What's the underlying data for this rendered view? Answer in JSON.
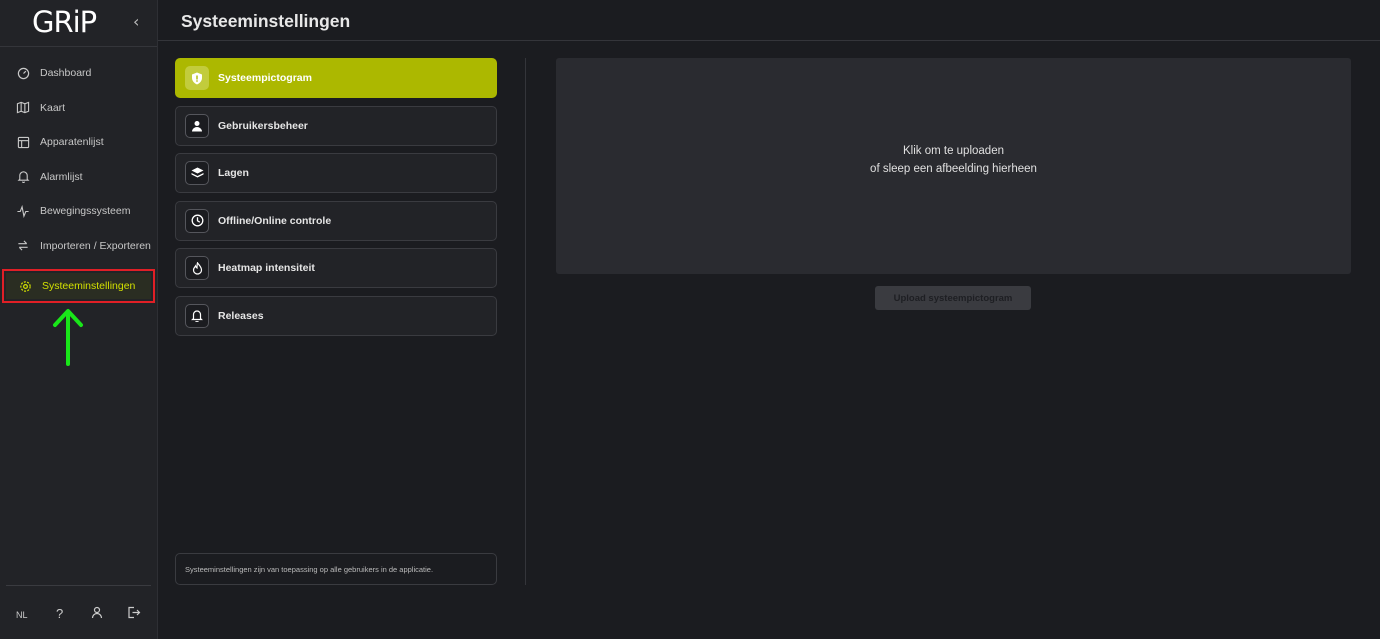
{
  "app": {
    "logo_text": "GRiP",
    "collapse_icon": "chevron-left-icon"
  },
  "sidebar": {
    "items": [
      {
        "label": "Dashboard",
        "icon": "gauge-icon"
      },
      {
        "label": "Kaart",
        "icon": "map-icon"
      },
      {
        "label": "Apparatenlijst",
        "icon": "table-icon"
      },
      {
        "label": "Alarmlijst",
        "icon": "bell-icon"
      },
      {
        "label": "Bewegingssysteem",
        "icon": "activity-icon"
      },
      {
        "label": "Importeren / Exporteren",
        "icon": "arrows-swap-icon"
      },
      {
        "label": "Systeeminstellingen",
        "icon": "gear-icon",
        "active": true
      }
    ],
    "bottom": {
      "language": "NL",
      "help": "?"
    }
  },
  "header": {
    "title": "Systeeminstellingen"
  },
  "settings_menu": {
    "items": [
      {
        "label": "Systeempictogram",
        "icon": "shield-icon",
        "active": true
      },
      {
        "label": "Gebruikersbeheer",
        "icon": "user-icon"
      },
      {
        "label": "Lagen",
        "icon": "layers-icon"
      },
      {
        "label": "Offline/Online controle",
        "icon": "clock-icon"
      },
      {
        "label": "Heatmap intensiteit",
        "icon": "flame-icon"
      },
      {
        "label": "Releases",
        "icon": "bell-icon"
      }
    ],
    "footer_note": "Systeeminstellingen zijn van toepassing op alle gebruikers in de applicatie."
  },
  "upload": {
    "line1": "Klik om te uploaden",
    "line2": "of sleep een afbeelding hierheen",
    "button_label": "Upload systeempictogram"
  },
  "colors": {
    "accent": "#acb800",
    "active_nav_text": "#d2e000",
    "highlight_box": "#e01f26",
    "arrow": "#19e619"
  }
}
